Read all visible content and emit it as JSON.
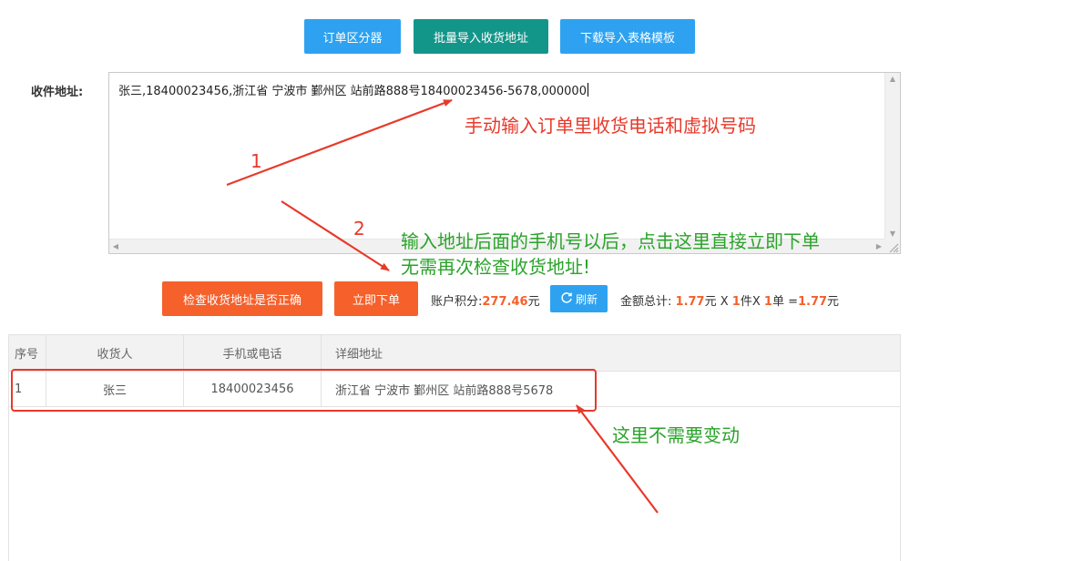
{
  "toolbar": {
    "separator_label": "订单区分器",
    "bulk_import_label": "批量导入收货地址",
    "download_template_label": "下载导入表格模板"
  },
  "address": {
    "label": "收件地址:",
    "value": "张三,18400023456,浙江省 宁波市 鄞州区 站前路888号18400023456-5678,000000"
  },
  "annotations": {
    "step1_number": "1",
    "step1_text": "手动输入订单里收货电话和虚拟号码",
    "step2_number": "2",
    "step2_line1": "输入地址后面的手机号以后，点击这里直接立即下单",
    "step2_line2": "无需再次检查收货地址!",
    "step3_text": "这里不需要变动"
  },
  "actions": {
    "check_label": "检查收货地址是否正确",
    "order_now_label": "立即下单"
  },
  "account": {
    "points_label": "账户积分:",
    "points_value": "277.46",
    "points_unit": "元",
    "refresh_label": "刷新",
    "total_label": "金额总计:",
    "unit_price": "1.77",
    "yuan": "元",
    "times": " X ",
    "qty": "1",
    "piece_unit": "件X ",
    "orders": "1",
    "order_unit": "单 =",
    "total_value": "1.77",
    "total_unit": "元"
  },
  "table": {
    "headers": [
      "序号",
      "收货人",
      "手机或电话",
      "详细地址"
    ],
    "rows": [
      [
        "1",
        "张三",
        "18400023456",
        "浙江省 宁波市 鄞州区 站前路888号5678"
      ]
    ]
  },
  "colors": {
    "blue": "#2ea2f0",
    "teal": "#13968a",
    "orange": "#f5602b",
    "annotation_red": "#e8392a",
    "annotation_green": "#2aa32a"
  },
  "icons": {
    "refresh": "refresh-icon"
  }
}
